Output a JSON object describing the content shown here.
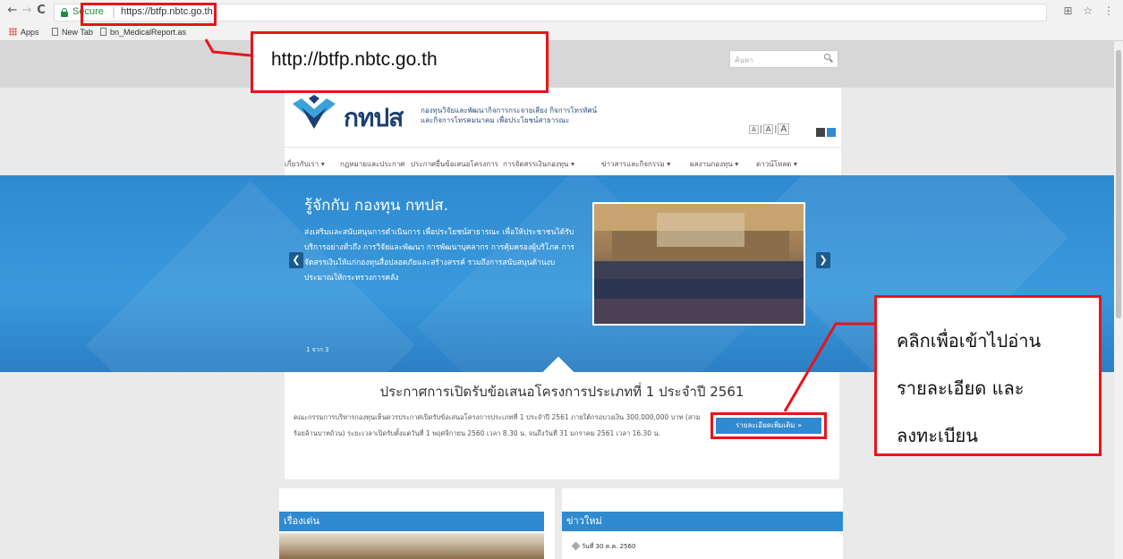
{
  "browser": {
    "nav": {
      "back": "←",
      "forward": "→",
      "reload": "C"
    },
    "secure_label": "Secure",
    "url": "https://btfp.nbtc.go.th",
    "bookmarks": [
      "Apps",
      "New Tab",
      "bn_MedicalReport.as"
    ],
    "icons": [
      "translate-icon",
      "star-icon",
      "menu-icon"
    ]
  },
  "site": {
    "search": {
      "placeholder": "ค้นหา"
    },
    "logo": "กทปส",
    "tagline": [
      "กองทุนวิจัยและพัฒนากิจการกระจายเสียง กิจการโทรทัศน์",
      "และกิจการโทรคมนาคม เพื่อประโยชน์สาธารณะ"
    ],
    "font_sizes": [
      "A",
      "A",
      "A"
    ],
    "nav": [
      "เกี่ยวกับเรา ▾",
      "กฎหมายและประกาศ",
      "ประกาศยื่นข้อเสนอโครงการ",
      "การจัดสรรเงินกองทุน ▾",
      "ข่าวสารและกิจกรรม ▾",
      "ผลงานกองทุน ▾",
      "ดาวน์โหลด ▾"
    ],
    "hero": {
      "title": "รู้จักกับ กองทุน กทปส.",
      "description": "ส่งเสริมและสนับสนุนการดำเนินการ เพื่อประโยชน์สาธารณะ เพื่อให้ประชาชนได้รับบริการอย่างทั่วถึง การวิจัยและพัฒนา การพัฒนาบุคลากร การคุ้มครองผู้บริโภค การจัดสรรเงินให้แก่กองทุนสื่อปลอดภัยและสร้างสรรค์ รวมถึงการสนับสนุนด้านงบประมาณให้กระทรวงการคลัง",
      "counter": "1 จาก 3",
      "prev": "❮",
      "next": "❯"
    },
    "announcement": {
      "title": "ประกาศการเปิดรับข้อเสนอโครงการประเภทที่ 1 ประจำปี 2561",
      "body": "คณะกรรมการบริหารกองทุนเห็นควรประกาศเปิดรับข้อเสนอโครงการประเภทที่ 1 ประจำปี 2561 ภายใต้กรอบวงเงิน 300,000,000 บาท (สามร้อยล้านบาทถ้วน) ระยะเวลาเปิดรับตั้งแต่วันที่ 1 พฤศจิกายน 2560 เวลา 8.30 น. จนถึงวันที่ 31 มกราคม 2561 เวลา 16.30 น.",
      "more_button": "รายละเอียดเพิ่มเติม »"
    },
    "featured": {
      "title": "เรื่องเด่น"
    },
    "news": {
      "title": "ข่าวใหม่",
      "date": "วันที่ 30 ต.ค. 2560"
    }
  },
  "annotations": {
    "url_callout": "http://btfp.nbtc.go.th",
    "read_callout": [
      "คลิกเพื่อเข้าไปอ่าน",
      "รายละเอียด และ",
      "ลงทะเบียน"
    ]
  },
  "colors": {
    "highlight": "#e8141b",
    "brand_blue": "#2f8ad0",
    "brand_navy": "#1c3f73"
  }
}
